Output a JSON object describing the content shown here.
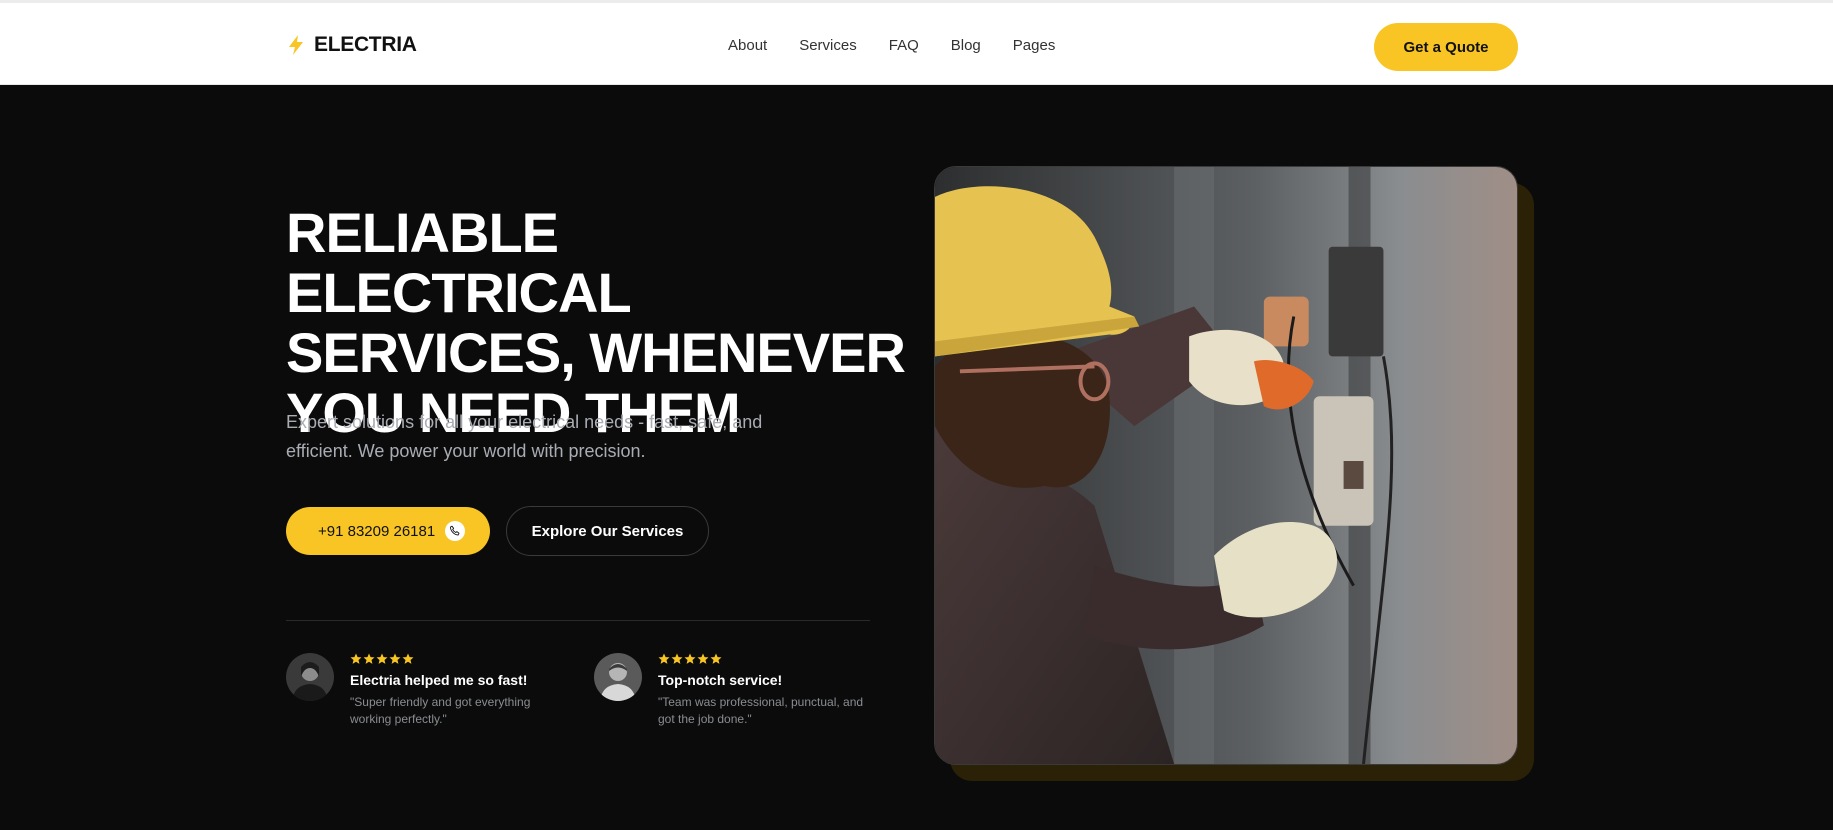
{
  "header": {
    "brand": "ELECTRIA",
    "brand_icon": "lightning-bolt-icon",
    "nav": [
      "About",
      "Services",
      "FAQ",
      "Blog",
      "Pages"
    ],
    "cta": "Get a Quote"
  },
  "hero": {
    "title": "RELIABLE ELECTRICAL SERVICES, WHENEVER YOU NEED THEM",
    "subtitle": "Expert solutions for all your electrical needs - fast, safe, and efficient. We power your world with precision.",
    "phone_button": "+91 83209 26181",
    "phone_icon": "phone-icon",
    "explore_button": "Explore Our Services"
  },
  "reviews": [
    {
      "rating": 5,
      "title": "Electria helped me so fast!",
      "quote": "\"Super friendly and got everything working perfectly.\""
    },
    {
      "rating": 5,
      "title": "Top-notch service!",
      "quote": "\"Team was professional, punctual, and got the job done.\""
    }
  ],
  "colors": {
    "accent": "#f8c524",
    "background": "#0b0b0b",
    "header_bg": "#ffffff"
  }
}
